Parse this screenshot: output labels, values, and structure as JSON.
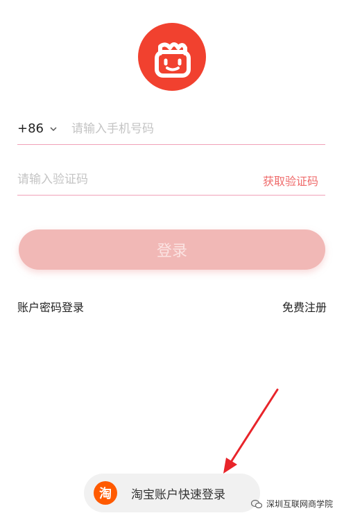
{
  "form": {
    "country_code": "+86",
    "phone_placeholder": "请输入手机号码",
    "code_placeholder": "请输入验证码",
    "get_code_label": "获取验证码",
    "login_label": "登录",
    "password_login_label": "账户密码登录",
    "register_label": "免费注册"
  },
  "taobao": {
    "icon_text": "淘",
    "label": "淘宝账户快速登录"
  },
  "watermark": {
    "text": "深圳互联网商学院"
  },
  "colors": {
    "brand": "#f1412f",
    "accent": "#ef6b6b",
    "button_disabled": "#f1b8b6",
    "taobao_orange": "#ff5a00",
    "annotation_arrow": "#e8242a"
  }
}
